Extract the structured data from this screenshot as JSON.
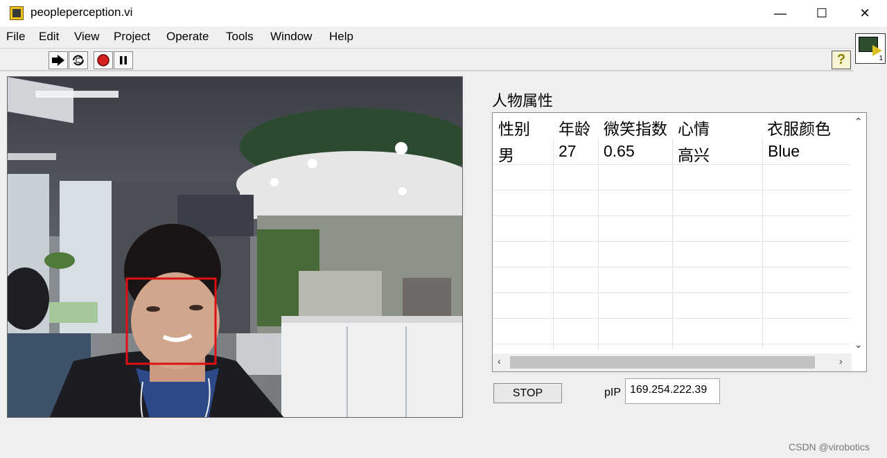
{
  "window": {
    "title": "peopleperception.vi",
    "controls": [
      "—",
      "☐",
      "✕"
    ]
  },
  "menu": [
    "File",
    "Edit",
    "View",
    "Project",
    "Operate",
    "Tools",
    "Window",
    "Help"
  ],
  "toolbar": {
    "buttons": [
      "run-icon",
      "run-continuously-icon",
      "abort-icon",
      "pause-icon"
    ],
    "help_label": "?"
  },
  "vi_icon": {
    "number": "1"
  },
  "table": {
    "caption": "人物属性",
    "headers": [
      "性别",
      "年龄",
      "微笑指数",
      "心情",
      "衣服颜色"
    ],
    "rows": [
      [
        "男",
        "27",
        "0.65",
        "高兴",
        "Blue"
      ]
    ]
  },
  "stop_button": {
    "label": "STOP"
  },
  "ip": {
    "label": "pIP",
    "value": "169.254.222.39"
  },
  "watermark": "CSDN @virobotics",
  "colors": {
    "face_box": "#e01010",
    "accent": "#cc2222"
  }
}
